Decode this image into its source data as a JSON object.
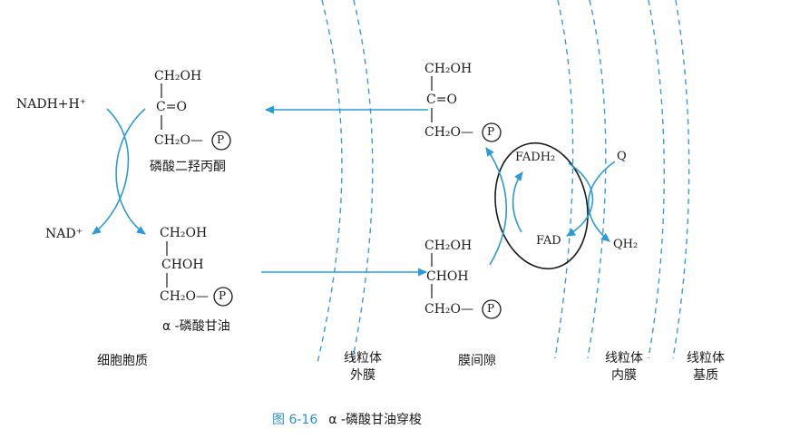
{
  "caption": {
    "figure_number": "图 6-16",
    "title": "α -磷酸甘油穿梭"
  },
  "regions": {
    "cytosol": "细胞胞质",
    "outer_membrane": [
      "线粒体",
      "外膜"
    ],
    "intermembrane_space": "膜间隙",
    "inner_membrane": [
      "线粒体",
      "内膜"
    ],
    "matrix": [
      "线粒体",
      "基质"
    ]
  },
  "compounds": {
    "dhap_name": "磷酸二羟丙酮",
    "g3p_name": "α -磷酸甘油",
    "ch2oh": "CH₂OH",
    "c_double_o": "C=O",
    "choh": "CHOH",
    "ch2o": "CH₂O—",
    "phosphate": "P"
  },
  "cofactors": {
    "nadh": "NADH+H⁺",
    "nad": "NAD⁺",
    "fadh2": "FADH₂",
    "fad": "FAD",
    "q": "Q",
    "qh2": "QH₂"
  },
  "colors": {
    "arrow": "#2a9bd6",
    "membrane": "#3a9bd8",
    "caption_number": "#2a8fd1"
  }
}
